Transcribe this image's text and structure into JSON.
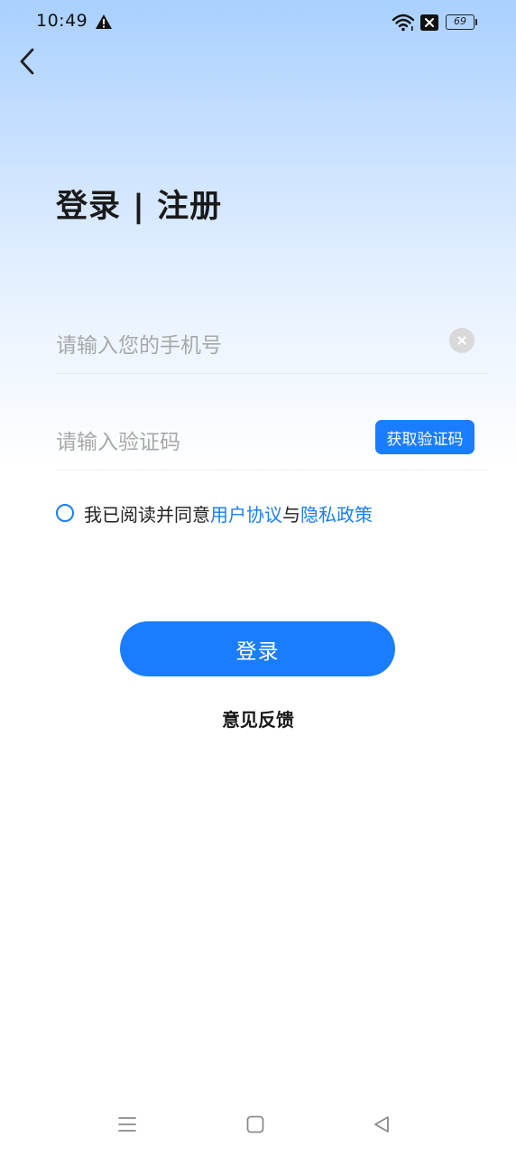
{
  "status_bar": {
    "time": "10:49",
    "battery_level": "69",
    "warning_icon": "warning-triangle-icon",
    "wifi_icon": "wifi-icon",
    "x_icon": "close-box-icon"
  },
  "header": {
    "back_icon": "chevron-left-icon"
  },
  "page_title": "登录 | 注册",
  "form": {
    "phone_placeholder": "请输入您的手机号",
    "phone_value": "",
    "code_placeholder": "请输入验证码",
    "code_value": "",
    "get_code_label": "获取验证码",
    "clear_icon": "clear-circle-icon"
  },
  "agreement": {
    "prefix": "我已阅读并同意",
    "user_agreement": "用户协议",
    "connector": "与",
    "privacy_policy": "隐私政策",
    "checked": false
  },
  "login_label": "登录",
  "feedback_label": "意见反馈",
  "colors": {
    "accent": "#1a7dff",
    "title": "#1a1a1a",
    "placeholder": "#a8a8a8"
  },
  "nav_bar": {
    "menu_icon": "menu-lines-icon",
    "home_icon": "square-home-icon",
    "back_icon": "triangle-back-icon"
  }
}
